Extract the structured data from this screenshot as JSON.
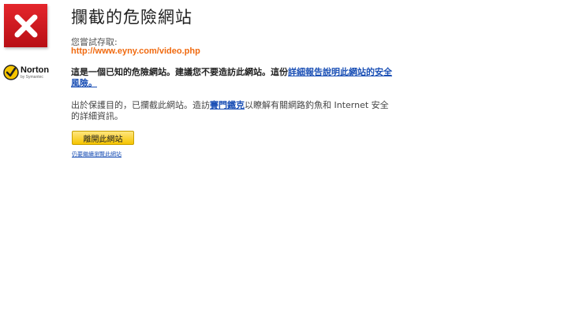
{
  "page": {
    "title": "攔截的危險網站",
    "attempt_label": "您嘗試存取:",
    "url": "http://www.eyny.com/video.php",
    "danger_text": "這是一個已知的危險網站。建議您不要造訪此網站。這份",
    "danger_link": "詳細報告說明此網站的安全風險。",
    "info_text_before": "出於保護目的，已攔截此網站。造訪",
    "info_link": "賽門鐵克",
    "info_text_after": "以瞭解有關網路釣魚和 Internet 安全的詳細資訊。",
    "leave_button": "離開此網站",
    "continue_link": "仍要繼續瀏覽此網站"
  },
  "logo": {
    "name": "Norton",
    "sub": "by Symantec"
  },
  "icons": {
    "warning": "x-icon",
    "logo_check": "check-icon"
  },
  "colors": {
    "warning_red": "#d7161c",
    "url_orange": "#f06a10",
    "link_blue": "#1a4fb5",
    "button_yellow": "#f5c400"
  }
}
